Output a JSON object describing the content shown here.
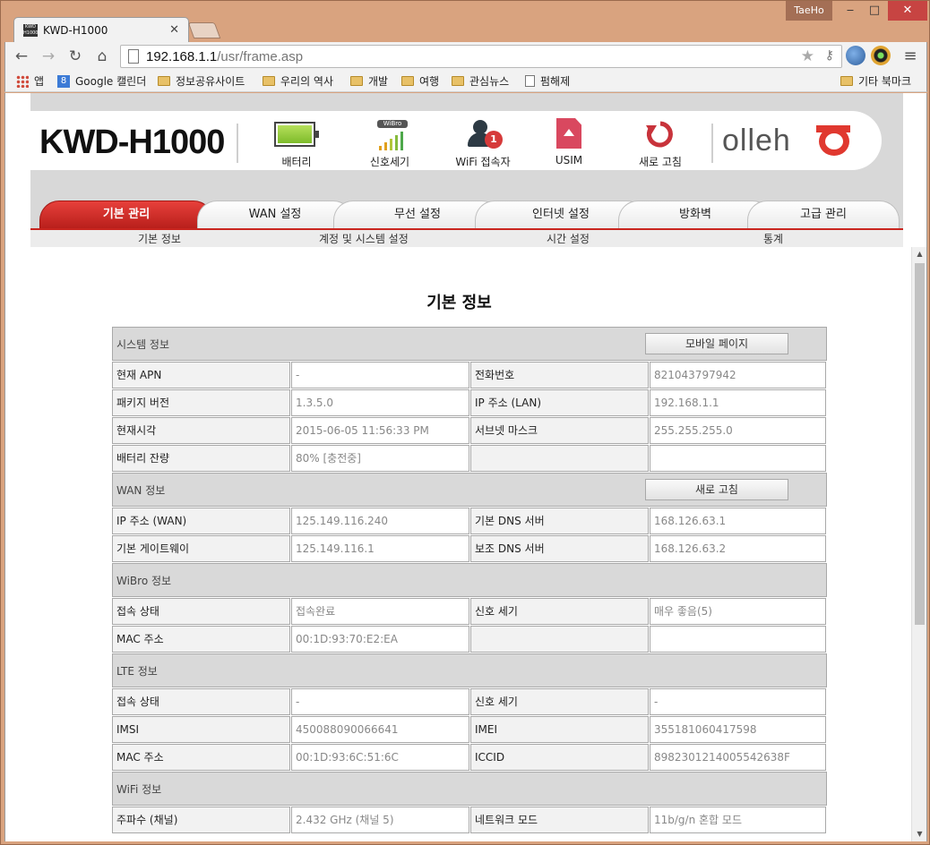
{
  "browser": {
    "tab_title": "KWD-H1000",
    "tab_favicon_text": "KWD H1000",
    "user": "TaeHo",
    "url_host": "192.168.1.1",
    "url_path": "/usr/frame.asp",
    "bookmarks": [
      "앱",
      "Google 캘린더",
      "정보공유사이트",
      "우리의 역사",
      "개발",
      "여행",
      "관심뉴스",
      "펌해제"
    ],
    "other_bookmarks": "기타 북마크"
  },
  "header": {
    "model": "KWD-H1000",
    "wibro_tag": "WiBro",
    "wifi_clients": "1",
    "status_items": [
      "배터리",
      "신호세기",
      "WiFi 접속자",
      "USIM",
      "새로 고침"
    ],
    "brand": "olleh",
    "battery_level": 1.0,
    "signal_level": 5
  },
  "nav": {
    "tabs": [
      "기본 관리",
      "WAN 설정",
      "무선 설정",
      "인터넷 설정",
      "방화벽",
      "고급 관리"
    ],
    "active_tab": 0,
    "sub_items": [
      "기본 정보",
      "계정 및 시스템 설정",
      "시간 설정",
      "통계"
    ]
  },
  "page": {
    "heading": "기본 정보",
    "sections": [
      {
        "title": "시스템 정보",
        "button": "모바일 페이지",
        "rows": [
          [
            "현재 APN",
            "-",
            "전화번호",
            "821043797942"
          ],
          [
            "패키지 버전",
            "1.3.5.0",
            "IP 주소 (LAN)",
            "192.168.1.1"
          ],
          [
            "현재시각",
            "2015-06-05 11:56:33 PM",
            "서브넷 마스크",
            "255.255.255.0"
          ],
          [
            "배터리 잔량",
            "80% [충전중]",
            "",
            ""
          ]
        ]
      },
      {
        "title": "WAN 정보",
        "button": "새로 고침",
        "rows": [
          [
            "IP 주소 (WAN)",
            "125.149.116.240",
            "기본 DNS 서버",
            "168.126.63.1"
          ],
          [
            "기본 게이트웨이",
            "125.149.116.1",
            "보조 DNS 서버",
            "168.126.63.2"
          ]
        ]
      },
      {
        "title": "WiBro 정보",
        "button": "",
        "rows": [
          [
            "접속 상태",
            "접속완료",
            "신호 세기",
            "매우 좋음(5)"
          ],
          [
            "MAC 주소",
            "00:1D:93:70:E2:EA",
            "",
            ""
          ]
        ]
      },
      {
        "title": "LTE 정보",
        "button": "",
        "rows": [
          [
            "접속 상태",
            "-",
            "신호 세기",
            "-"
          ],
          [
            "IMSI",
            "450088090066641",
            "IMEI",
            "355181060417598"
          ],
          [
            "MAC 주소",
            "00:1D:93:6C:51:6C",
            "ICCID",
            "8982301214005542638F"
          ]
        ]
      },
      {
        "title": "WiFi 정보",
        "button": "",
        "rows": [
          [
            "주파수 (채널)",
            "2.432 GHz (채널 5)",
            "네트워크 모드",
            "11b/g/n 혼합 모드"
          ]
        ]
      }
    ]
  },
  "colors": {
    "accent_red": "#c9251f",
    "brand_red": "#e0382f",
    "battery_green": "#7dbb2a"
  }
}
